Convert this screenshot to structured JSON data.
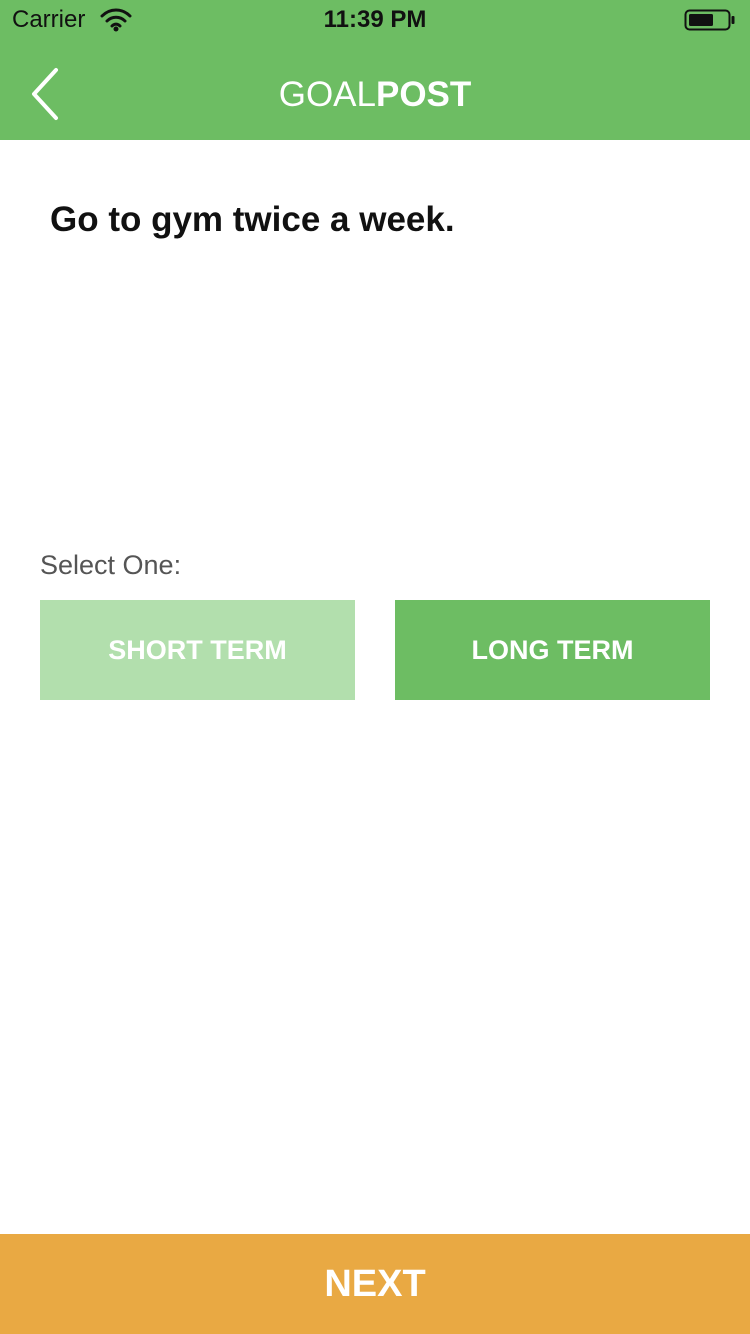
{
  "status_bar": {
    "carrier": "Carrier",
    "time": "11:39 PM",
    "icons": [
      "wifi-icon",
      "battery-icon"
    ]
  },
  "header": {
    "title_light": "GOAL",
    "title_bold": "POST",
    "back_icon": "chevron-left-icon"
  },
  "goal": {
    "text": "Go to gym twice a week."
  },
  "selection": {
    "label": "Select One:",
    "options": [
      {
        "label": "SHORT TERM",
        "selected": false
      },
      {
        "label": "LONG TERM",
        "selected": true
      }
    ]
  },
  "footer": {
    "next_label": "NEXT"
  },
  "colors": {
    "header_green": "#6dbd63",
    "selected_green": "#6dbd63",
    "unselected_green": "#b2dfad",
    "next_orange": "#e9a943",
    "text_dark": "#111111",
    "label_gray": "#555555"
  }
}
